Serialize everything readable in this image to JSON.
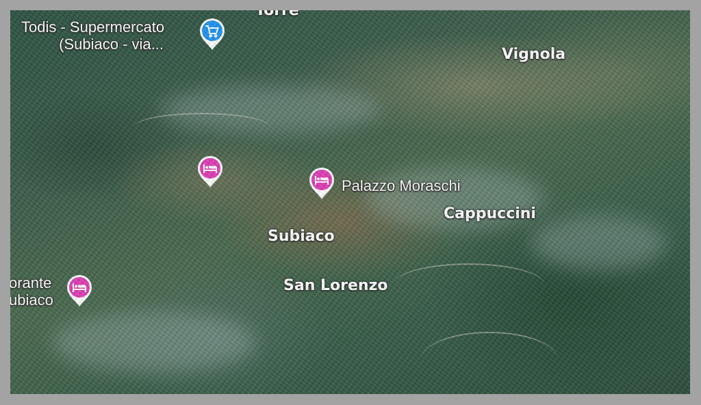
{
  "map": {
    "view": "satellite-3d",
    "colors": {
      "hotel_pin": "#e040b8",
      "shop_pin": "#2196f3",
      "label_text": "#ffffff"
    },
    "place_labels": {
      "torre": "Torre",
      "vignola": "Vignola",
      "cappuccini": "Cappuccini",
      "subiaco": "Subiaco",
      "san_lorenzo": "San Lorenzo"
    },
    "poi_labels": {
      "todis_line1": "Todis - Supermercato",
      "todis_line2": "(Subiaco -  via...",
      "palazzo_moraschi": "Palazzo Moraschi",
      "restaurant_line1": "orante",
      "restaurant_line2": "ubiaco"
    },
    "pins": {
      "todis": {
        "icon": "shopping-cart-icon",
        "category": "shop"
      },
      "hotel_west": {
        "icon": "bed-icon",
        "category": "hotel"
      },
      "palazzo_moraschi": {
        "icon": "bed-icon",
        "category": "hotel"
      },
      "restaurant": {
        "icon": "bed-icon",
        "category": "hotel"
      }
    }
  }
}
